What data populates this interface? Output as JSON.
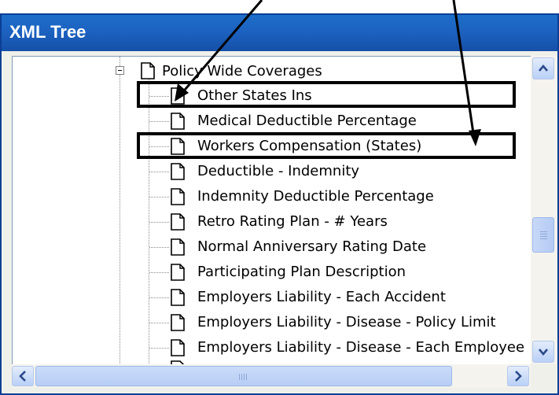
{
  "window": {
    "title": "XML Tree"
  },
  "tree": {
    "parent": {
      "label": "Policy Wide Coverages"
    },
    "items": [
      {
        "label": "Other States Ins"
      },
      {
        "label": "Medical Deductible Percentage"
      },
      {
        "label": "Workers Compensation (States)"
      },
      {
        "label": "Deductible - Indemnity"
      },
      {
        "label": "Indemnity Deductible Percentage"
      },
      {
        "label": "Retro Rating Plan - # Years"
      },
      {
        "label": "Normal Anniversary Rating Date"
      },
      {
        "label": "Participating Plan Description"
      },
      {
        "label": "Employers Liability - Each Accident"
      },
      {
        "label": "Employers Liability - Disease - Policy Limit"
      },
      {
        "label": "Employers Liability - Disease - Each Employee"
      }
    ]
  },
  "highlighted_items": [
    "Other States Ins",
    "Workers Compensation (States)"
  ],
  "icons": {
    "expander": "minus-expander-icon",
    "node": "document-icon",
    "scroll_up": "arrow-up-icon",
    "scroll_down": "arrow-down-icon",
    "scroll_left": "arrow-left-icon",
    "scroll_right": "arrow-right-icon"
  },
  "colors": {
    "titlebar": "#1d63c1",
    "scroll_button": "#c4d6f8",
    "annotation": "#000000"
  }
}
